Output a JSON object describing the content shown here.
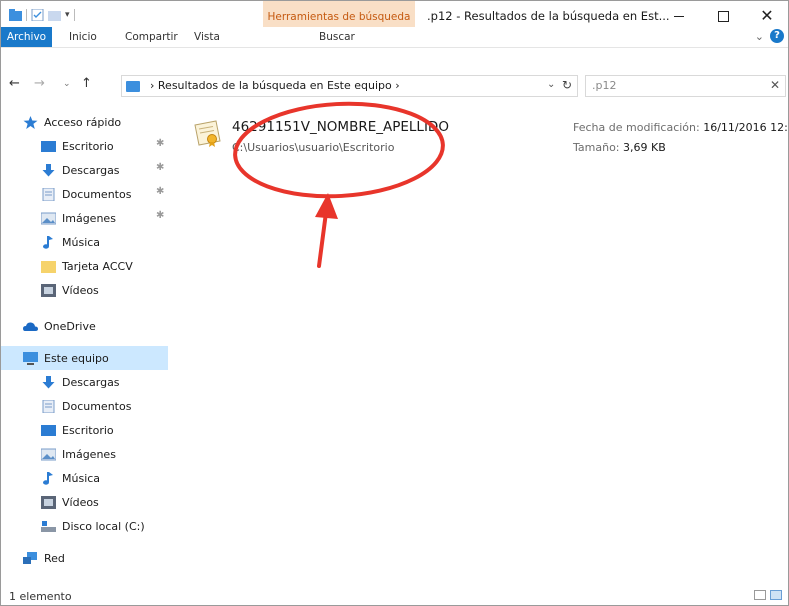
{
  "window": {
    "title": ".p12 - Resultados de la búsqueda en Est...",
    "context_tab": "Herramientas de búsqueda"
  },
  "ribbon": {
    "tabs": [
      "Archivo",
      "Inicio",
      "Compartir",
      "Vista",
      "Buscar"
    ]
  },
  "address": {
    "path": "Resultados de la búsqueda en Este equipo",
    "separator": "›"
  },
  "search": {
    "value": ".p12"
  },
  "navpane": {
    "quick_access": "Acceso rápido",
    "quick_items": [
      "Escritorio",
      "Descargas",
      "Documentos",
      "Imágenes",
      "Música",
      "Tarjeta ACCV",
      "Vídeos"
    ],
    "onedrive": "OneDrive",
    "this_pc": "Este equipo",
    "pc_items": [
      "Descargas",
      "Documentos",
      "Escritorio",
      "Imágenes",
      "Música",
      "Vídeos",
      "Disco local (C:)"
    ],
    "network": "Red"
  },
  "result": {
    "name": "46291151V_NOMBRE_APELLIDO",
    "path": "C:\\Usuarios\\usuario\\Escritorio",
    "modified_label": "Fecha de modificación:",
    "modified_value": "16/11/2016 12:...",
    "size_label": "Tamaño:",
    "size_value": "3,69 KB"
  },
  "status": {
    "count": "1 elemento"
  },
  "colors": {
    "accent": "#1979ca",
    "context_tab_bg": "#f9dfc6",
    "context_tab_text": "#c55a11",
    "selection": "#cce8ff",
    "annotation": "#e8352b"
  },
  "icons": {
    "quick_access": "star-icon",
    "desktop": "desktop-folder-icon",
    "downloads": "download-arrow-icon",
    "documents": "document-folder-icon",
    "pictures": "pictures-folder-icon",
    "music": "music-note-icon",
    "folder": "folder-icon",
    "videos": "video-folder-icon",
    "onedrive": "cloud-icon",
    "pc": "computer-icon",
    "disk": "disk-drive-icon",
    "network": "network-icon",
    "certificate": "certificate-file-icon"
  }
}
